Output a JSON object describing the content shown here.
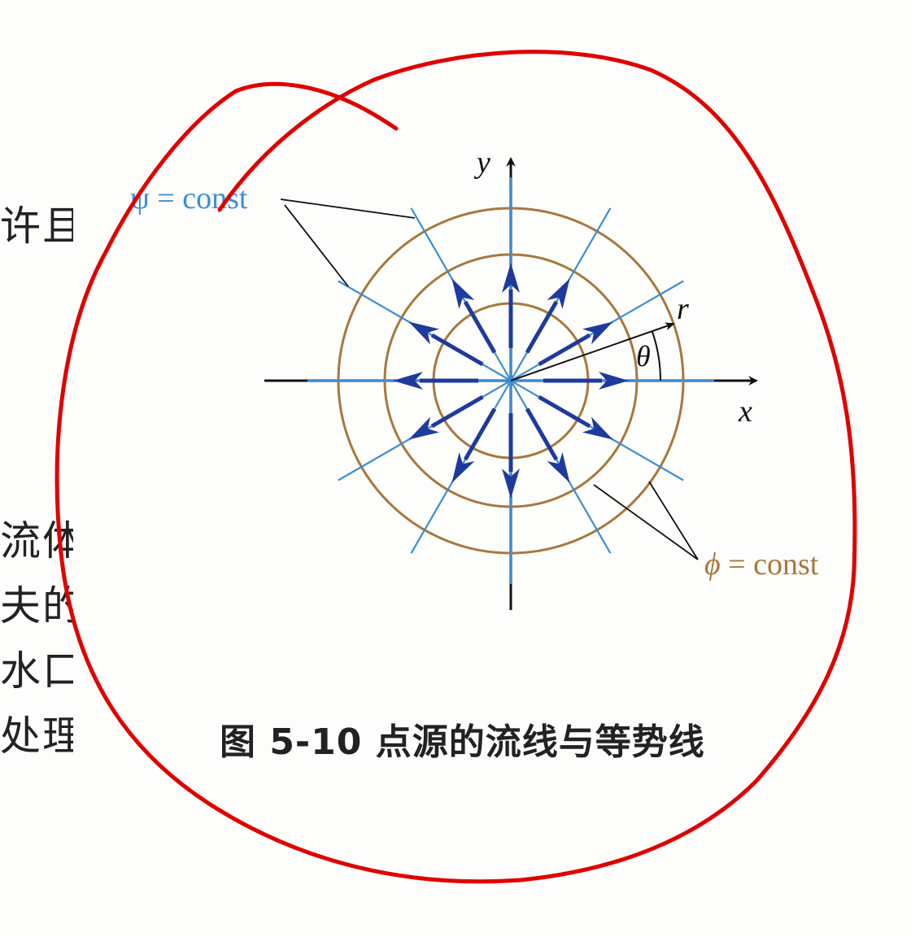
{
  "figure": {
    "caption": "图 5-10  点源的流线与等势线",
    "labels": {
      "psi": "ψ = const",
      "phi_symbol": "ϕ",
      "phi_rest": " = const",
      "x": "x",
      "y": "y",
      "r": "r",
      "theta": "θ"
    },
    "colors": {
      "streamlines": "#3a8fd6",
      "equipotentials": "#a8783c",
      "arrows": "#1f3a9e",
      "annotation": "#d80000"
    },
    "arrow_count": 12,
    "streamline_count": 12,
    "equipotential_count": 3
  },
  "left_margin_text": [
    "许且",
    "流体",
    "夫的",
    "水口",
    "处理"
  ]
}
